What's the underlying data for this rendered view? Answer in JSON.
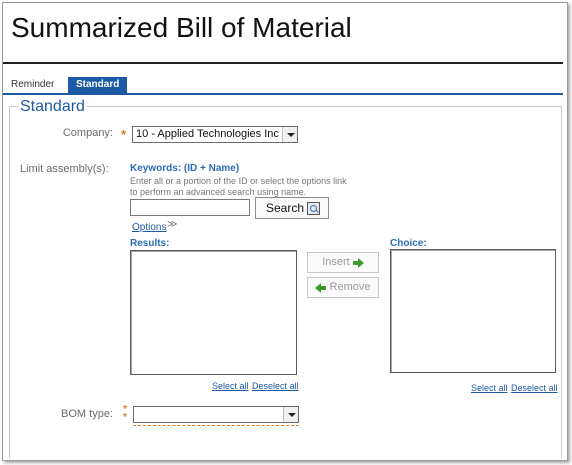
{
  "page": {
    "title": "Summarized Bill of Material"
  },
  "tabs": [
    {
      "label": "Reminder",
      "active": false
    },
    {
      "label": "Standard",
      "active": true
    }
  ],
  "section": {
    "legend": "Standard"
  },
  "company": {
    "label": "Company:",
    "required_mark": "*",
    "value": "10 - Applied Technologies Inc"
  },
  "limit_assembly": {
    "label": "Limit assembly(s):",
    "keywords_label": "Keywords: (ID + Name)",
    "help_text": "Enter all or a portion of the ID or select the options link to perform an advanced search using name.",
    "search_value": "",
    "search_button_label": "Search",
    "options_label": "Options",
    "options_chevron": "≫",
    "results_label": "Results:",
    "choice_label": "Choice:",
    "insert_label": "Insert",
    "remove_label": "Remove",
    "results_select_all": "Select all",
    "results_deselect_all": "Deselect all",
    "choice_select_all": "Select all",
    "choice_deselect_all": "Deselect all"
  },
  "bom_type": {
    "label": "BOM type:",
    "required_mark_top": "*",
    "required_mark_bottom": "*",
    "value": ""
  },
  "colors": {
    "accent": "#1d5aa6",
    "required": "#e07b1f",
    "move_arrow": "#3a9a2a"
  },
  "icons": {
    "search": "search-icon",
    "insert": "arrow-right-icon",
    "remove": "arrow-left-icon",
    "dropdown": "chevron-down-icon"
  }
}
